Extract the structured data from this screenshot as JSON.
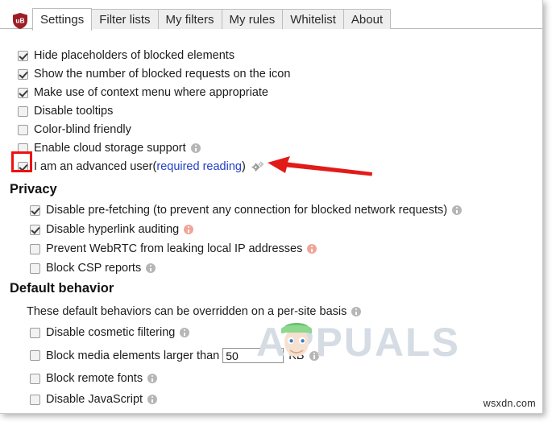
{
  "window": {
    "logo_name": "ublock-origin-shield-logo",
    "logo_text": "uB"
  },
  "tabs": [
    {
      "label": "Settings",
      "active": true
    },
    {
      "label": "Filter lists",
      "active": false
    },
    {
      "label": "My filters",
      "active": false
    },
    {
      "label": "My rules",
      "active": false
    },
    {
      "label": "Whitelist",
      "active": false
    },
    {
      "label": "About",
      "active": false
    }
  ],
  "general": {
    "options": [
      {
        "label": "Hide placeholders of blocked elements",
        "checked": true,
        "info": "none"
      },
      {
        "label": "Show the number of blocked requests on the icon",
        "checked": true,
        "info": "none"
      },
      {
        "label": "Make use of context menu where appropriate",
        "checked": true,
        "info": "none"
      },
      {
        "label": "Disable tooltips",
        "checked": false,
        "info": "none"
      },
      {
        "label": "Color-blind friendly",
        "checked": false,
        "info": "none"
      },
      {
        "label": "Enable cloud storage support",
        "checked": false,
        "info": "gray"
      }
    ],
    "advanced": {
      "prefix": "I am an advanced user ",
      "link_open": "(",
      "link_text": "required reading",
      "link_close": ")",
      "checked": true
    }
  },
  "privacy": {
    "heading": "Privacy",
    "options": [
      {
        "label": "Disable pre-fetching (to prevent any connection for blocked network requests)",
        "checked": true,
        "info": "gray"
      },
      {
        "label": "Disable hyperlink auditing",
        "checked": true,
        "info": "salmon"
      },
      {
        "label": "Prevent WebRTC from leaking local IP addresses",
        "checked": false,
        "info": "salmon"
      },
      {
        "label": "Block CSP reports",
        "checked": false,
        "info": "gray"
      }
    ]
  },
  "default_behavior": {
    "heading": "Default behavior",
    "description": "These default behaviors can be overridden on a per-site basis",
    "description_info": "gray",
    "options": [
      {
        "label": "Disable cosmetic filtering",
        "checked": false,
        "info": "gray"
      },
      {
        "label": "Block remote fonts",
        "checked": false,
        "info": "gray"
      },
      {
        "label": "Disable JavaScript",
        "checked": false,
        "info": "gray"
      }
    ],
    "media": {
      "label": "Block media elements larger than",
      "checked": false,
      "value": "50",
      "unit": "KB",
      "info": "gray"
    }
  },
  "annotations": {
    "arrow_color": "#e21b18",
    "highlight_color": "#ee1111"
  },
  "watermarks": {
    "brand": "APPUALS",
    "source": "wsxdn.com"
  }
}
